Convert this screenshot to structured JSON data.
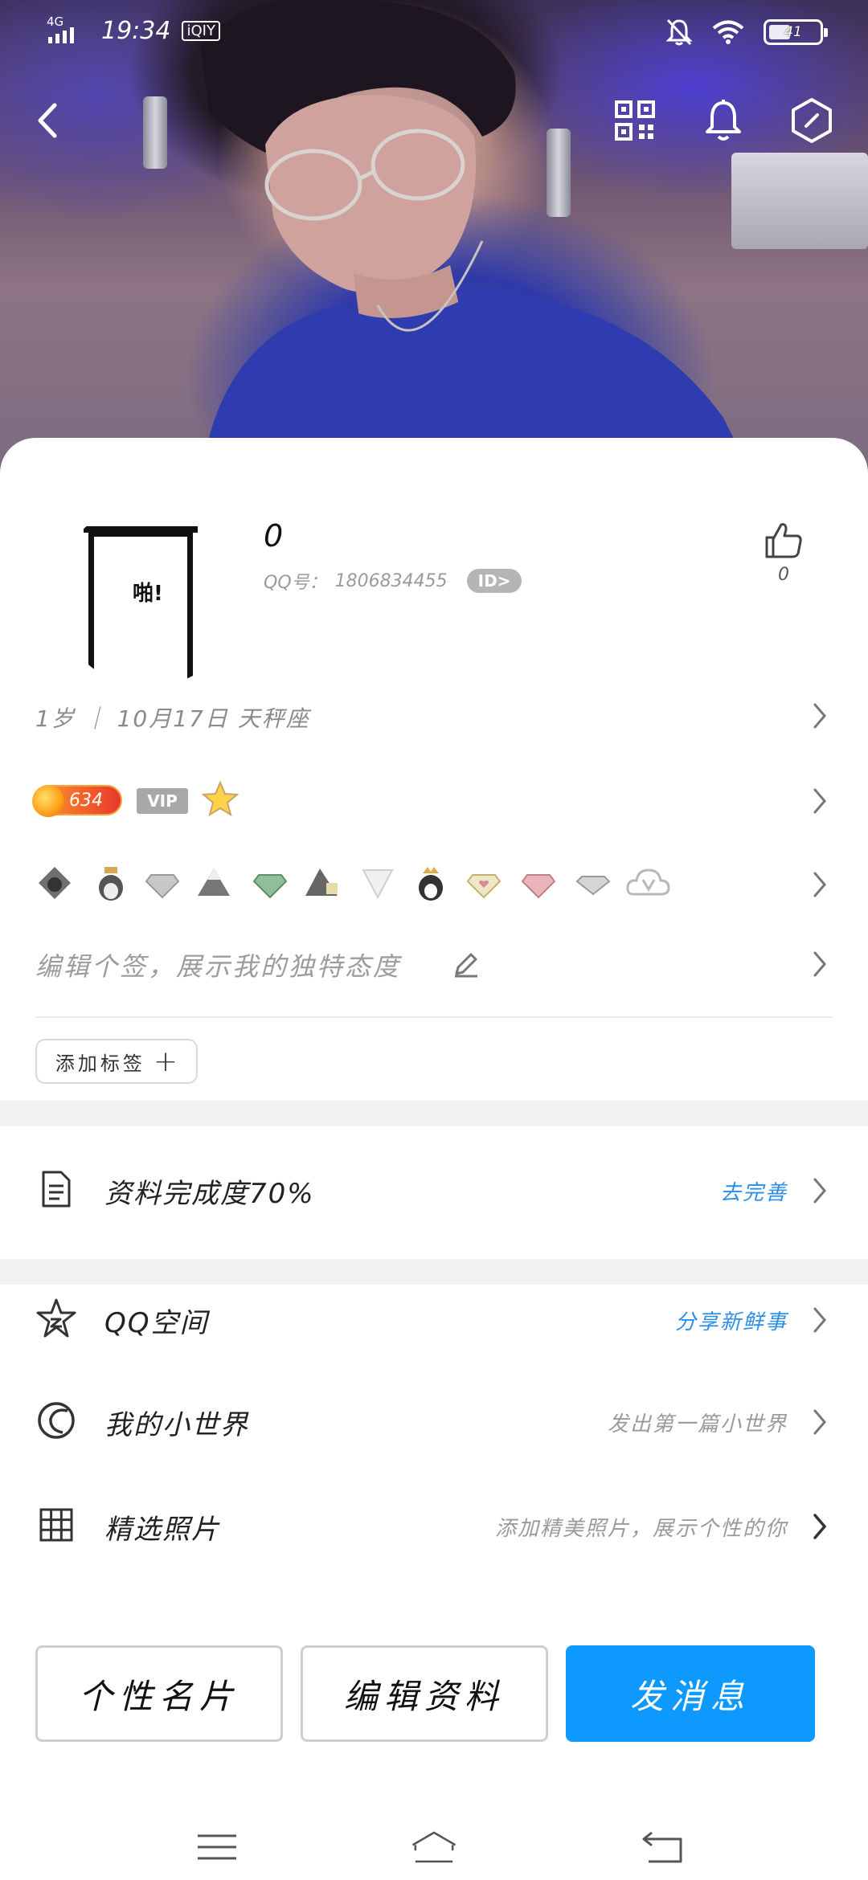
{
  "status_bar": {
    "network": "4G",
    "time": "19:34",
    "app_badge": "iQIY",
    "battery": "41"
  },
  "header": {
    "back_icon": "chevron-left-icon",
    "qr_icon": "qr-code-icon",
    "bell_icon": "bell-icon",
    "settings_icon": "hexagon-settings-icon"
  },
  "profile": {
    "avatar_text": "啪!",
    "nickname": "0",
    "qq_label": "QQ号：",
    "qq_number": "1806834455",
    "id_badge": "ID>",
    "like_count": "0",
    "info_line": "1岁 ｜ 10月17日  天秤座",
    "level": "634",
    "vip_label": "VIP",
    "signature_placeholder": "编辑个签，展示我的独特态度",
    "add_tag_label": "添加标签"
  },
  "completion": {
    "label": "资料完成度70%",
    "action": "去完善"
  },
  "menu": [
    {
      "label": "QQ空间",
      "hint": "分享新鲜事",
      "icon": "qzone-star-icon"
    },
    {
      "label": "我的小世界",
      "hint": "发出第一篇小世界",
      "icon": "small-world-icon"
    },
    {
      "label": "精选照片",
      "hint": "添加精美照片，展示个性的你",
      "icon": "photo-grid-icon"
    }
  ],
  "bottom_buttons": {
    "card": "个性名片",
    "edit": "编辑资料",
    "message": "发消息"
  },
  "colors": {
    "accent": "#0d99ff",
    "link_blue": "#2b8ee8",
    "muted_text": "#9a9a9a"
  }
}
